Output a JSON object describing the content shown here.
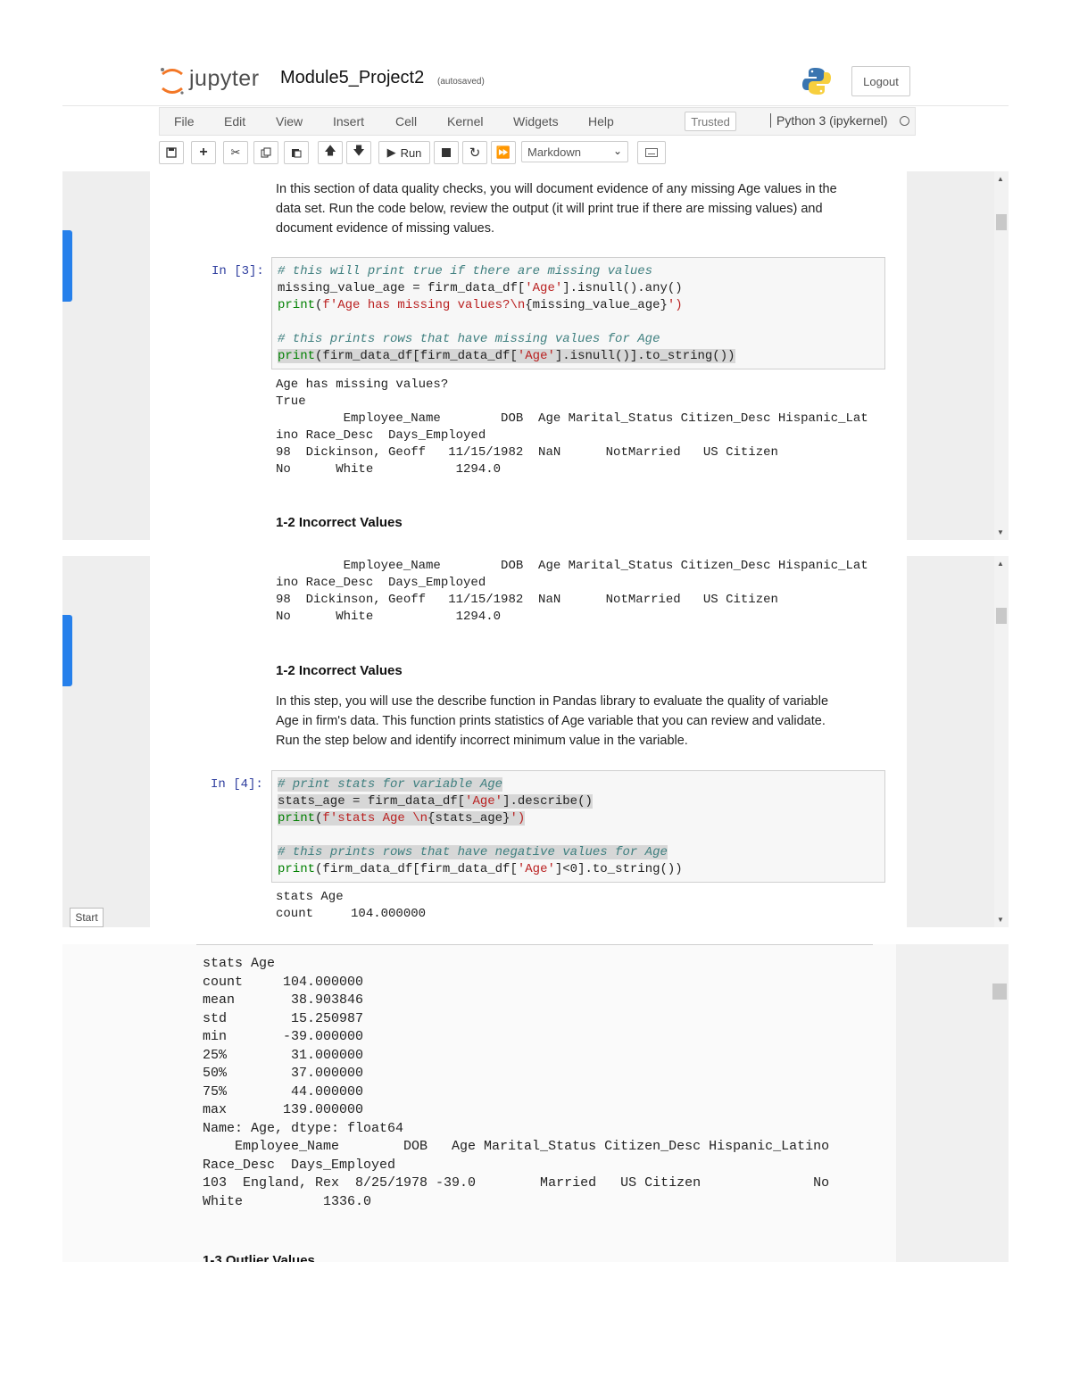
{
  "header": {
    "logo_text": "jupyter",
    "notebook_title": "Module5_Project2",
    "autosave": "(autosaved)",
    "logout_label": "Logout",
    "menu": [
      "File",
      "Edit",
      "View",
      "Insert",
      "Cell",
      "Kernel",
      "Widgets",
      "Help"
    ],
    "trusted_label": "Trusted",
    "kernel_name": "Python 3 (ipykernel)"
  },
  "toolbar": {
    "run_label": "Run",
    "cell_type": "Markdown"
  },
  "panel1": {
    "intro": [
      "In this section of data quality checks, you will document evidence of any missing Age values in the",
      "data set. Run the code below, review the output (it will print true if there are missing values) and",
      "document evidence of missing values."
    ],
    "prompt": "In [3]:",
    "code": {
      "c1": "# this will print true if there are missing values",
      "l2a": "missing_value_age = firm_data_df[",
      "l2b": "'Age'",
      "l2c": "].isnull().any()",
      "l3a": "print",
      "l3b": "(",
      "l3c": "f'Age has missing values?\\n",
      "l3d": "{missing_value_age}",
      "l3e": "')",
      "c2": "# this prints rows that have missing values for Age",
      "l5a": "print",
      "l5b": "(firm_data_df[firm_data_df[",
      "l5c": "'Age'",
      "l5d": "].isnull()].to_string())"
    },
    "output": [
      "Age has missing values?",
      "True",
      "         Employee_Name        DOB  Age Marital_Status Citizen_Desc Hispanic_Lat",
      "ino Race_Desc  Days_Employed",
      "98  Dickinson, Geoff   11/15/1982  NaN      NotMarried   US Citizen",
      "No      White           1294.0"
    ],
    "heading": "1-2 Incorrect Values"
  },
  "panel2": {
    "output_top": [
      "         Employee_Name        DOB  Age Marital_Status Citizen_Desc Hispanic_Lat",
      "ino Race_Desc  Days_Employed",
      "98  Dickinson, Geoff   11/15/1982  NaN      NotMarried   US Citizen",
      "No      White           1294.0"
    ],
    "heading": "1-2 Incorrect Values",
    "intro": [
      "In this step, you will use the describe function in Pandas library to evaluate the quality of variable",
      "Age in firm's data. This function prints statistics of Age variable that you can review and validate.",
      "Run the step below and identify incorrect minimum value in the variable."
    ],
    "prompt": "In [4]:",
    "code": {
      "c1": "# print stats for variable Age",
      "l2a": "stats_age = firm_data_df[",
      "l2b": "'Age'",
      "l2c": "].describe()",
      "l3a": "print",
      "l3b": "(",
      "l3c": "f'stats Age \\n",
      "l3d": "{stats_age}",
      "l3e": "')",
      "c2": "# this prints rows that have negative values for Age",
      "l5a": "print",
      "l5b": "(firm_data_df[firm_data_df[",
      "l5c": "'Age'",
      "l5d": "]<0].to_string())"
    },
    "output": [
      "stats Age",
      "count     104.000000"
    ],
    "start_label": "Start"
  },
  "panel3": {
    "output": [
      "stats Age",
      "count     104.000000",
      "mean       38.903846",
      "std        15.250987",
      "min       -39.000000",
      "25%        31.000000",
      "50%        37.000000",
      "75%        44.000000",
      "max       139.000000",
      "Name: Age, dtype: float64",
      "    Employee_Name        DOB   Age Marital_Status Citizen_Desc Hispanic_Latino",
      "Race_Desc  Days_Employed",
      "103  England, Rex  8/25/1978 -39.0        Married   US Citizen              No",
      "White          1336.0"
    ],
    "heading_partial": "1-3 Outlier Values"
  }
}
